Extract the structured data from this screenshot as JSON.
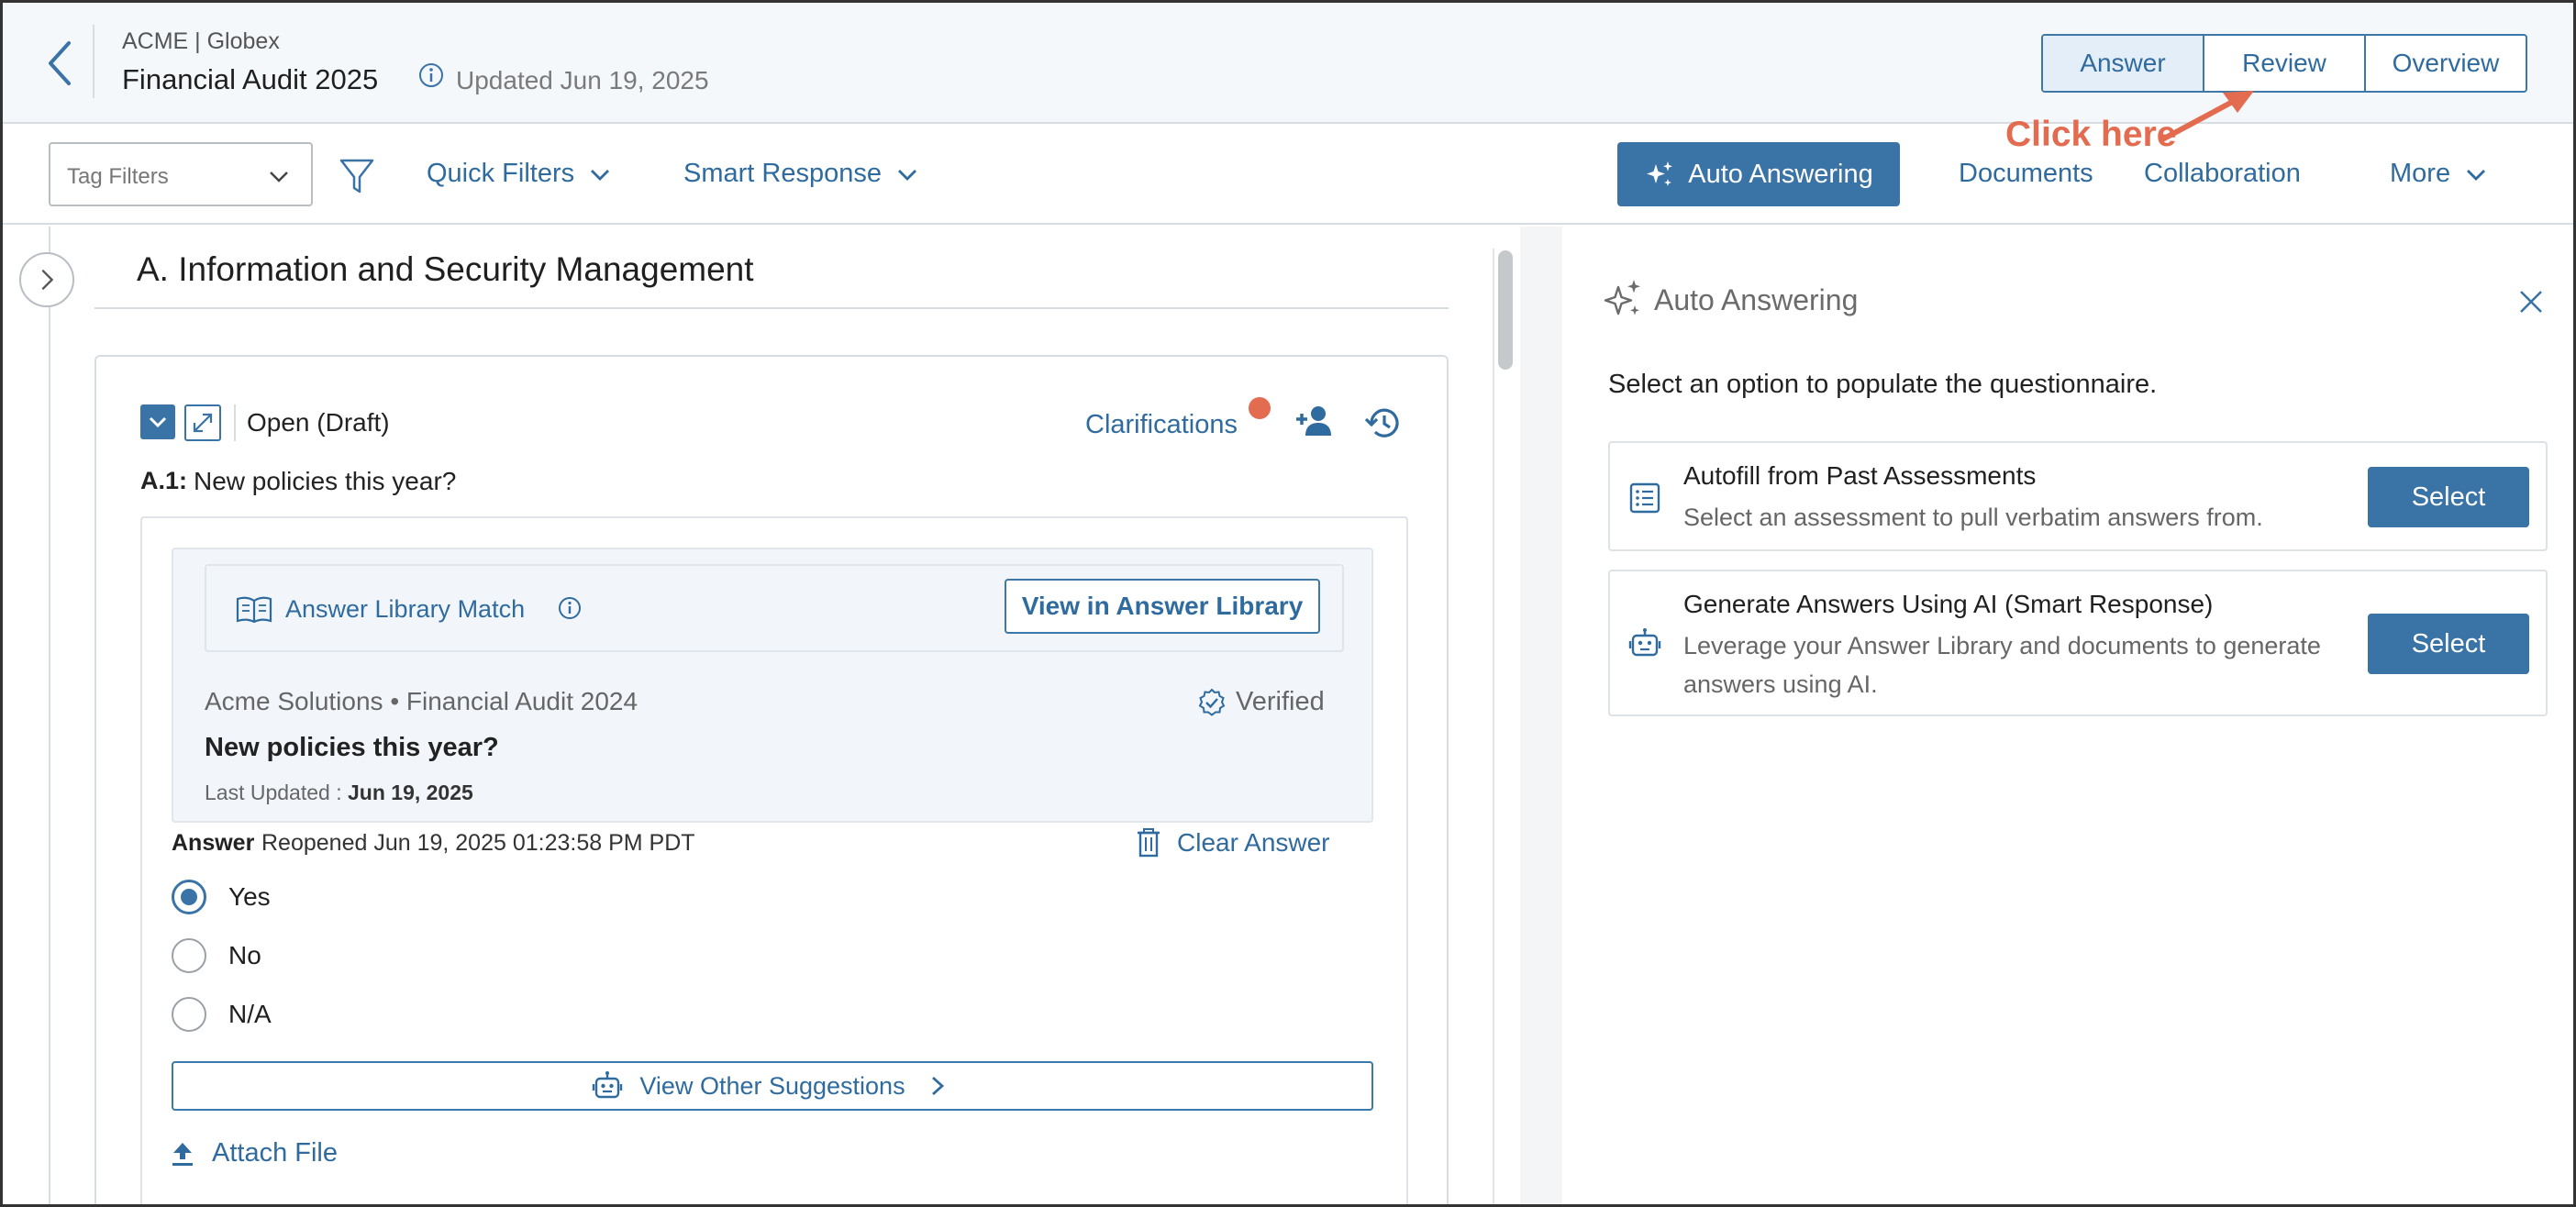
{
  "header": {
    "org": "ACME | Globex",
    "title": "Financial Audit 2025",
    "updated": "Updated Jun 19, 2025",
    "tabs": [
      {
        "label": "Answer",
        "active": true
      },
      {
        "label": "Review",
        "active": false
      },
      {
        "label": "Overview",
        "active": false
      }
    ],
    "callout": "Click here"
  },
  "toolbar": {
    "tag_filters_placeholder": "Tag Filters",
    "quick_filters": "Quick Filters",
    "smart_response": "Smart Response",
    "auto_answering": "Auto Answering",
    "documents": "Documents",
    "collaboration": "Collaboration",
    "more": "More"
  },
  "section": {
    "title": "A. Information and Security Management"
  },
  "question": {
    "status": "Open (Draft)",
    "clarifications": "Clarifications",
    "id": "A.1:",
    "text": "New policies this year?",
    "match": {
      "label": "Answer Library Match",
      "view_button": "View in Answer Library",
      "source": "Acme Solutions • Financial Audit 2024",
      "verified": "Verified",
      "question": "New policies this year?",
      "last_updated_label": "Last Updated :",
      "last_updated_value": "Jun 19, 2025"
    },
    "answer_label": "Answer",
    "answer_meta": "Reopened  Jun 19, 2025 01:23:58 PM PDT",
    "clear_answer": "Clear Answer",
    "options": [
      {
        "label": "Yes",
        "selected": true
      },
      {
        "label": "No",
        "selected": false
      },
      {
        "label": "N/A",
        "selected": false
      }
    ],
    "other_suggestions": "View Other Suggestions",
    "attach_file": "Attach File"
  },
  "panel": {
    "title": "Auto Answering",
    "subtitle": "Select an option to populate the questionnaire.",
    "options": [
      {
        "title": "Autofill from Past Assessments",
        "desc": "Select an assessment to pull verbatim answers from.",
        "button": "Select"
      },
      {
        "title": "Generate Answers Using AI (Smart Response)",
        "desc": "Leverage your Answer Library and documents to generate answers using AI.",
        "button": "Select"
      }
    ]
  },
  "colors": {
    "accent": "#3a73a6",
    "link": "#2f6b9e",
    "alert": "#e36b4f"
  }
}
